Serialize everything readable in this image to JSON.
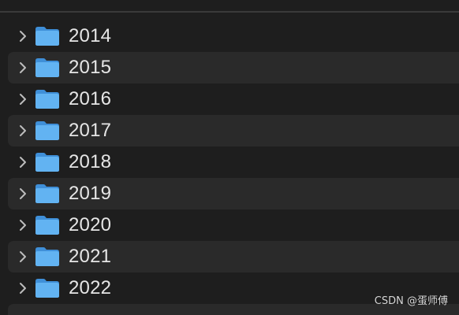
{
  "folders": [
    {
      "label": "2014",
      "icon": "folder-icon",
      "expand_icon": "chevron-right-icon"
    },
    {
      "label": "2015",
      "icon": "folder-icon",
      "expand_icon": "chevron-right-icon"
    },
    {
      "label": "2016",
      "icon": "folder-icon",
      "expand_icon": "chevron-right-icon"
    },
    {
      "label": "2017",
      "icon": "folder-icon",
      "expand_icon": "chevron-right-icon"
    },
    {
      "label": "2018",
      "icon": "folder-icon",
      "expand_icon": "chevron-right-icon"
    },
    {
      "label": "2019",
      "icon": "folder-icon",
      "expand_icon": "chevron-right-icon"
    },
    {
      "label": "2020",
      "icon": "folder-icon",
      "expand_icon": "chevron-right-icon"
    },
    {
      "label": "2021",
      "icon": "folder-icon",
      "expand_icon": "chevron-right-icon"
    },
    {
      "label": "2022",
      "icon": "folder-icon",
      "expand_icon": "chevron-right-icon"
    }
  ],
  "watermark": "CSDN @蛋师傅",
  "colors": {
    "background": "#1e1e1e",
    "alternate_row": "#2a2a2a",
    "folder_blue": "#5aaef0",
    "text": "#e6e6e6"
  }
}
